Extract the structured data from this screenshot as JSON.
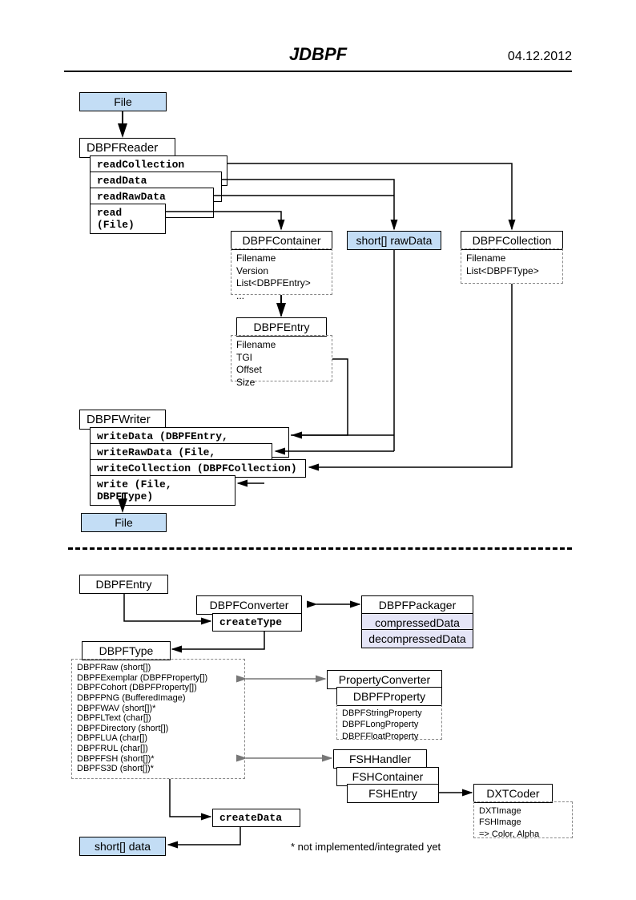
{
  "header": {
    "title": "JDBPF",
    "date": "04.12.2012"
  },
  "file_top": "File",
  "file_bottom": "File",
  "reader": {
    "title": "DBPFReader",
    "m1": "readCollection (File)",
    "m2": "readData (DBPFEntry)",
    "m3": "readRawData (File)",
    "m4": "read (File)"
  },
  "container": {
    "title": "DBPFContainer",
    "f1": "Filename",
    "f2": "Version",
    "f3": "List<DBPFEntry>",
    "f4": "..."
  },
  "rawdata": "short[] rawData",
  "collection": {
    "title": "DBPFCollection",
    "f1": "Filename",
    "f2": "List<DBPFType>"
  },
  "entry": {
    "title": "DBPFEntry",
    "f1": "Filename",
    "f2": "TGI",
    "f3": "Offset",
    "f4": "Size"
  },
  "writer": {
    "title": "DBPFWriter",
    "m1": "writeData (DBPFEntry, short[])",
    "m2": "writeRawData (File, short[])",
    "m3": "writeCollection (DBPFCollection)",
    "m4": "write (File, DBPFType)"
  },
  "entry2": "DBPFEntry",
  "converter": {
    "title": "DBPFConverter",
    "m1": "createType"
  },
  "packager": {
    "title": "DBPFPackager",
    "m1": "compressedData",
    "m2": "decompressedData"
  },
  "dbpftype": {
    "title": "DBPFType",
    "l1": "DBPFRaw (short[])",
    "l2": "DBPFExemplar (DBPFProperty[])",
    "l3": "DBPFCohort (DBPFProperty[])",
    "l4": "DBPFPNG (BufferedImage)",
    "l5": "DBPFWAV (short[])*",
    "l6": "DBPFLText (char[])",
    "l7": "DBPFDirectory (short[])",
    "l8": "DBPFLUA (char[])",
    "l9": "DBPFRUL (char[])",
    "l10": "DBPFFSH (short[])*",
    "l11": "DBPFS3D (short[])*"
  },
  "propconv": {
    "title": "PropertyConverter",
    "sub": "DBPFProperty",
    "l1": "DBPFStringProperty",
    "l2": "DBPFLongProperty",
    "l3": "DBPFFloatProperty"
  },
  "fsh": {
    "title": "FSHHandler",
    "sub1": "FSHContainer",
    "sub2": "FSHEntry"
  },
  "dxt": {
    "title": "DXTCoder",
    "l1": "DXTImage",
    "l2": "FSHImage",
    "l3": "=> Color, Alpha"
  },
  "createData": "createData",
  "shortdata": "short[] data",
  "footnote": "* not implemented/integrated yet"
}
